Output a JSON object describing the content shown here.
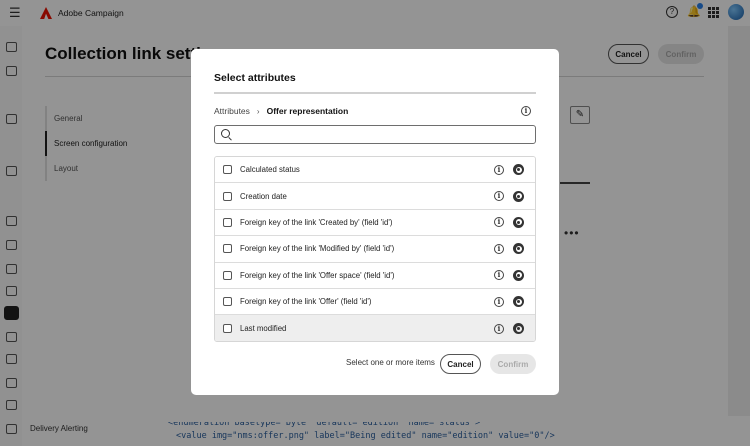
{
  "app": {
    "title": "Adobe Campaign"
  },
  "panel": {
    "title": "Collection link settings",
    "cancel_label": "Cancel",
    "confirm_label": "Confirm",
    "nav": [
      {
        "label": "General"
      },
      {
        "label": "Screen configuration"
      },
      {
        "label": "Layout"
      }
    ]
  },
  "background": {
    "sidebar_label": "Delivery Alerting",
    "code_line_1": "<enumeration basetype=\"byte\" default=\"edition\" name=\"status\">",
    "code_line_2": "<value img=\"nms:offer.png\" label=\"Being edited\" name=\"edition\" value=\"0\"/>"
  },
  "dialog": {
    "title": "Select attributes",
    "breadcrumb_root": "Attributes",
    "breadcrumb_current": "Offer representation",
    "search_value": "",
    "attributes": [
      {
        "label": "Calculated status"
      },
      {
        "label": "Creation date"
      },
      {
        "label": "Foreign key of the link 'Created by' (field 'id')"
      },
      {
        "label": "Foreign key of the link 'Modified by' (field 'id')"
      },
      {
        "label": "Foreign key of the link 'Offer space' (field 'id')"
      },
      {
        "label": "Foreign key of the link 'Offer' (field 'id')"
      },
      {
        "label": "Last modified"
      }
    ],
    "hint": "Select one or more items",
    "cancel_label": "Cancel",
    "confirm_label": "Confirm"
  }
}
